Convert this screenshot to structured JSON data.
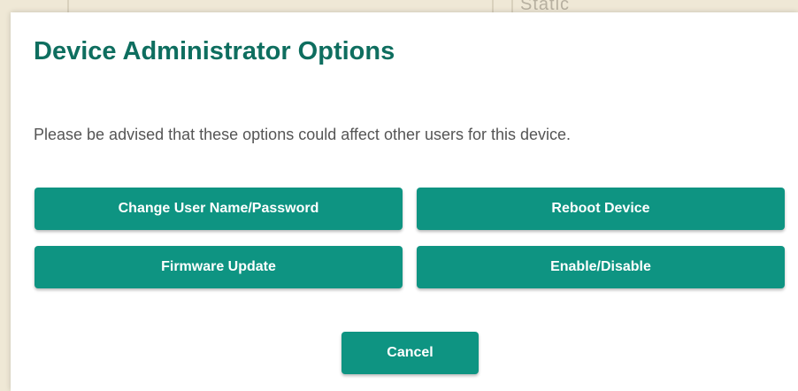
{
  "background": {
    "partial_text": "Static"
  },
  "dialog": {
    "title": "Device Administrator Options",
    "message": "Please be advised that these options could affect other users for this device.",
    "buttons": {
      "change_user": "Change User Name/Password",
      "reboot": "Reboot Device",
      "firmware": "Firmware Update",
      "enable_disable": "Enable/Disable",
      "cancel": "Cancel"
    }
  },
  "colors": {
    "accent": "#0e9482",
    "title": "#0e6e5f",
    "text": "#555555",
    "backdrop": "#efe8d6"
  }
}
